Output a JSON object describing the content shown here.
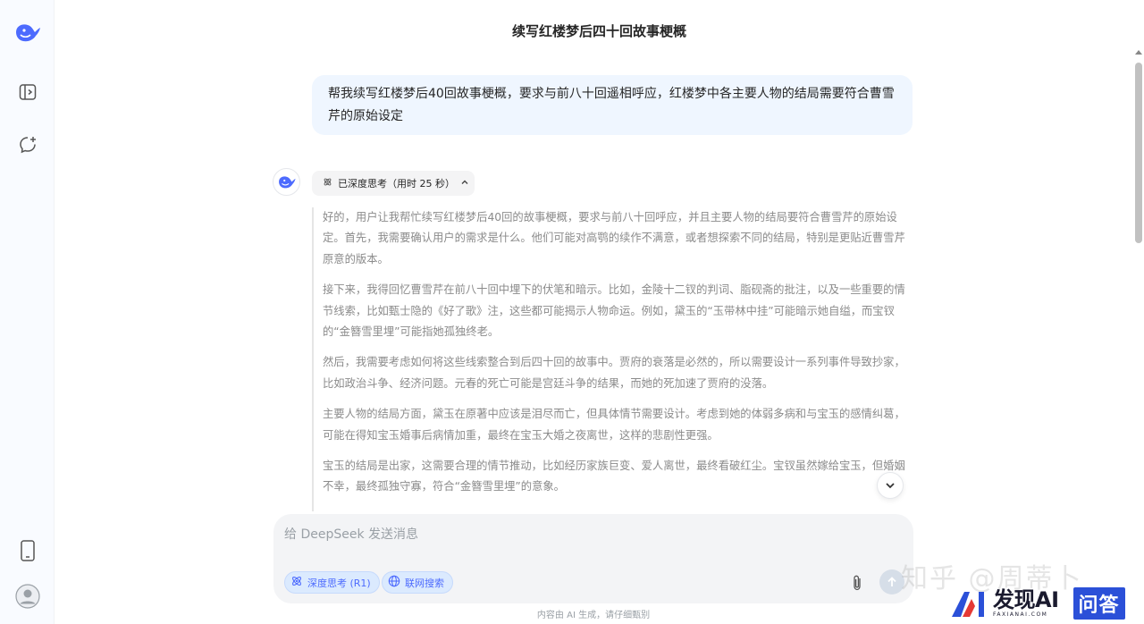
{
  "header": {
    "title": "续写红楼梦后四十回故事梗概"
  },
  "user_message": {
    "text": "帮我续写红楼梦后40回故事梗概，要求与前八十回遥相呼应，红楼梦中各主要人物的结局需要符合曹雪芹的原始设定"
  },
  "thinking": {
    "label": "已深度思考（用时 25 秒）",
    "paragraphs": [
      "好的，用户让我帮忙续写红楼梦后40回的故事梗概，要求与前八十回呼应，并且主要人物的结局要符合曹雪芹的原始设定。首先，我需要确认用户的需求是什么。他们可能对高鹗的续作不满意，或者想探索不同的结局，特别是更贴近曹雪芹原意的版本。",
      "接下来，我得回忆曹雪芹在前八十回中埋下的伏笔和暗示。比如，金陵十二钗的判词、脂砚斋的批注，以及一些重要的情节线索，比如甄士隐的《好了歌》注，这些都可能揭示人物命运。例如，黛玉的“玉带林中挂”可能暗示她自缢，而宝钗的“金簪雪里埋”可能指她孤独终老。",
      "然后，我需要考虑如何将这些线索整合到后四十回的故事中。贾府的衰落是必然的，所以需要设计一系列事件导致抄家，比如政治斗争、经济问题。元春的死亡可能是宫廷斗争的结果，而她的死加速了贾府的没落。",
      "主要人物的结局方面，黛玉在原著中应该是泪尽而亡，但具体情节需要设计。考虑到她的体弱多病和与宝玉的感情纠葛，可能在得知宝玉婚事后病情加重，最终在宝玉大婚之夜离世，这样的悲剧性更强。",
      "宝玉的结局是出家，这需要合理的情节推动，比如经历家族巨变、爱人离世，最终看破红尘。宝钗虽然嫁给宝玉，但婚姻不幸，最终孤独守寡，符合“金簪雪里埋”的意象。"
    ]
  },
  "composer": {
    "placeholder": "给 DeepSeek 发送消息",
    "deep_think_label": "深度思考 (R1)",
    "web_search_label": "联网搜索"
  },
  "footer": {
    "note": "内容由 AI 生成，请仔细甄别"
  },
  "watermarks": {
    "zhihu": "知乎 @周蒂卜",
    "faxian_main": "发现AI",
    "faxian_sub": "FAXIANAI.COM",
    "faxian_badge": "问答"
  },
  "colors": {
    "accent": "#4d6bfe",
    "user_bubble": "#eff6ff",
    "sidebar_bg": "#f9fbff"
  },
  "icons": [
    "deepseek-logo-icon",
    "sidebar-toggle-icon",
    "new-chat-icon",
    "phone-icon",
    "user-avatar-icon",
    "atom-icon",
    "chevron-up-icon",
    "chevron-down-icon",
    "globe-icon",
    "paperclip-icon",
    "arrow-up-icon"
  ]
}
